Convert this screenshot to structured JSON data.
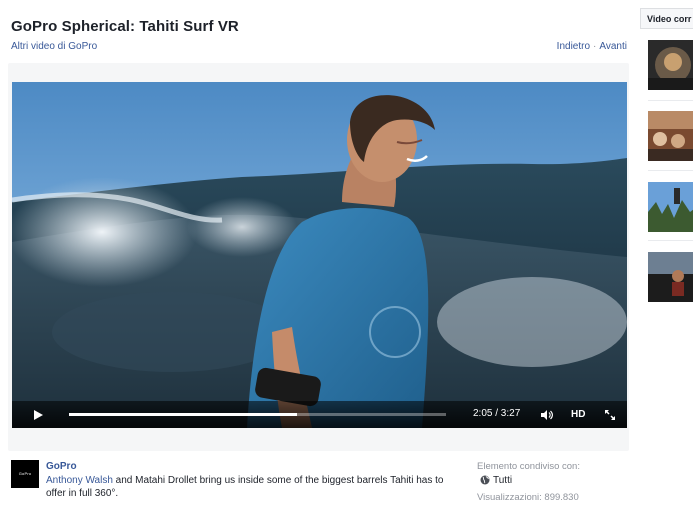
{
  "video": {
    "title": "GoPro Spherical: Tahiti Surf VR",
    "other_videos_link": "Altri video di GoPro",
    "back_link": "Indietro",
    "forward_link": "Avanti",
    "nav_separator": "·"
  },
  "player": {
    "current_time": "2:05",
    "duration": "3:27",
    "time_display": "2:05 / 3:27",
    "progress_fraction": 0.604,
    "hd_label": "HD"
  },
  "post": {
    "avatar_text": "GoPro",
    "page_name": "GoPro",
    "tagged_person": "Anthony Walsh",
    "description_rest": " and Matahi Drollet bring us inside some of the biggest barrels Tahiti has to offer in full 360°.",
    "shared_with_label": "Elemento condiviso con:",
    "audience": "Tutti",
    "views_label": "Visualizzazioni: 899.830"
  },
  "sidebar": {
    "header": "Video corr"
  },
  "icons": {
    "play": "play-icon",
    "volume": "volume-icon",
    "fullscreen": "fullscreen-icon",
    "globe": "globe-icon"
  },
  "colors": {
    "link": "#385898",
    "muted": "#90949c",
    "text": "#1d2129"
  }
}
